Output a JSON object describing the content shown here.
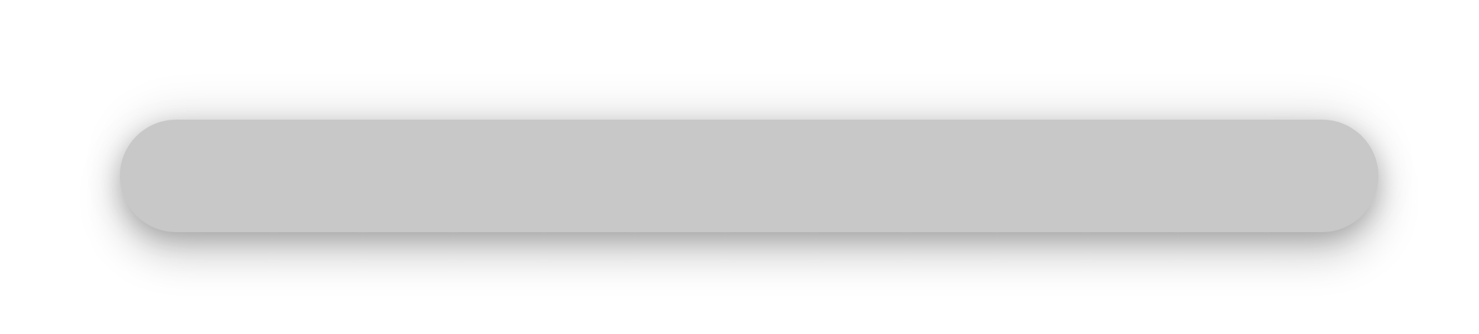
{
  "pill": {
    "fill_color": "#c8c8c8"
  },
  "background_color": "#ffffff"
}
